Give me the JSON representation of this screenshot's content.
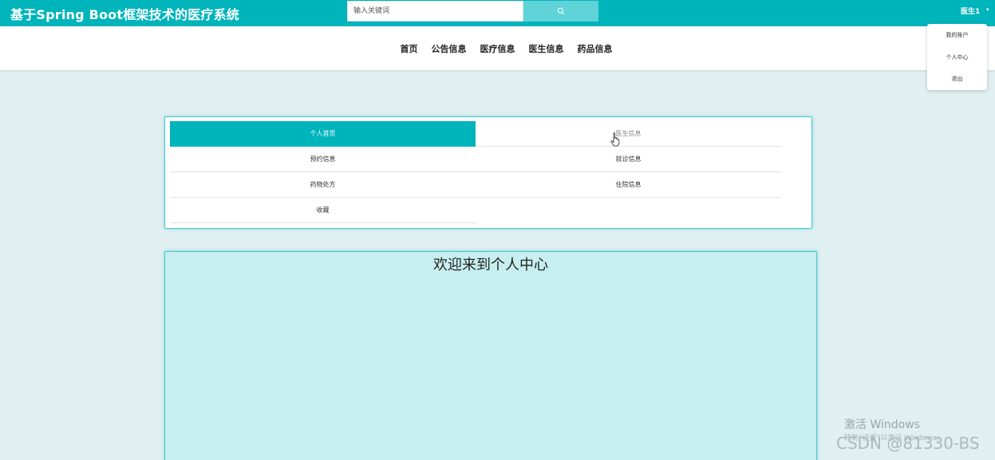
{
  "header": {
    "site_title": "基于Spring Boot框架技术的医疗系统",
    "search_placeholder": "输入关键词",
    "search_icon": "search-icon",
    "user_name": "医生1",
    "user_caret": "▾"
  },
  "nav": {
    "items": [
      "首页",
      "公告信息",
      "医疗信息",
      "医生信息",
      "药品信息"
    ]
  },
  "dropdown": {
    "items": [
      "我的账户",
      "个人中心",
      "退出"
    ]
  },
  "menu": {
    "items": [
      {
        "label": "个人首页",
        "active": true
      },
      {
        "label": "医生信息",
        "active": false
      },
      {
        "label": "预约信息",
        "active": false
      },
      {
        "label": "就诊信息",
        "active": false
      },
      {
        "label": "药物处方",
        "active": false
      },
      {
        "label": "住院信息",
        "active": false
      },
      {
        "label": "收藏",
        "active": false
      }
    ]
  },
  "welcome": {
    "title": "欢迎来到个人中心"
  },
  "watermark": {
    "windows": "激活 Windows",
    "windows_sub": "转到“设置”以激活 Windows。",
    "csdn": "CSDN @81330-BS"
  },
  "colors": {
    "brand": "#00b4bc",
    "search_button": "#5fd3d8",
    "page_bg": "#e0eff0",
    "welcome_bg": "#c8eff0"
  }
}
